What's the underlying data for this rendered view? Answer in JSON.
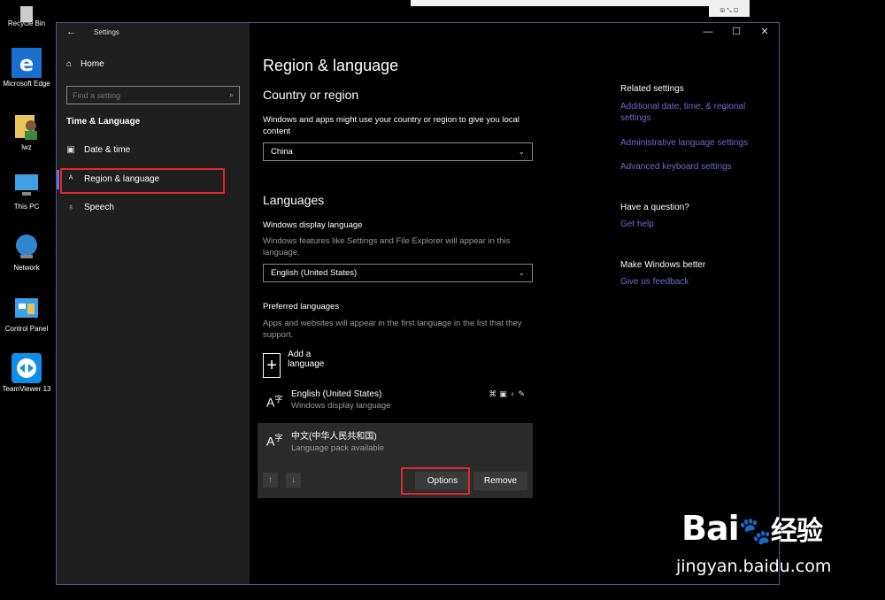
{
  "desktop": {
    "icons": [
      {
        "label": "Recycle Bin"
      },
      {
        "label": "Microsoft Edge"
      },
      {
        "label": "lwz"
      },
      {
        "label": "This PC"
      },
      {
        "label": "Network"
      },
      {
        "label": "Control Panel"
      },
      {
        "label": "TeamViewer 13"
      }
    ]
  },
  "window": {
    "title": "Settings",
    "controls": [
      "—",
      "☐",
      "✕"
    ]
  },
  "sidebar": {
    "home": "Home",
    "search_placeholder": "Find a setting",
    "section": "Time & Language",
    "items": [
      {
        "label": "Date & time",
        "icon": "calendar-clock-icon"
      },
      {
        "label": "Region & language",
        "icon": "language-icon",
        "selected": true
      },
      {
        "label": "Speech",
        "icon": "microphone-icon"
      }
    ]
  },
  "main": {
    "title": "Region & language",
    "country": {
      "heading": "Country or region",
      "desc": "Windows and apps might use your country or region to give you local content",
      "value": "China"
    },
    "languages": {
      "heading": "Languages",
      "display_label": "Windows display language",
      "display_desc": "Windows features like Settings and File Explorer will appear in this language.",
      "display_value": "English (United States)",
      "preferred_label": "Preferred languages",
      "preferred_desc": "Apps and websites will appear in the first language in the list that they support.",
      "add_label": "Add a language",
      "list": [
        {
          "name": "English (United States)",
          "sub": "Windows display language"
        },
        {
          "name": "中文(中华人民共和国)",
          "sub": "Language pack available"
        }
      ],
      "options_label": "Options",
      "remove_label": "Remove"
    }
  },
  "related": {
    "heading": "Related settings",
    "links": [
      "Additional date, time, & regional settings",
      "Administrative language settings",
      "Advanced keyboard settings"
    ],
    "question_heading": "Have a question?",
    "help_link": "Get help",
    "better_heading": "Make Windows better",
    "feedback_link": "Give us feedback"
  },
  "watermark": {
    "brand": "Bai",
    "brand2": "经验",
    "url": "jingyan.baidu.com"
  },
  "colors": {
    "accent": "#6b6bd0",
    "highlight_box": "#e0282a",
    "sidebar_bg": "#1f1f1f"
  }
}
